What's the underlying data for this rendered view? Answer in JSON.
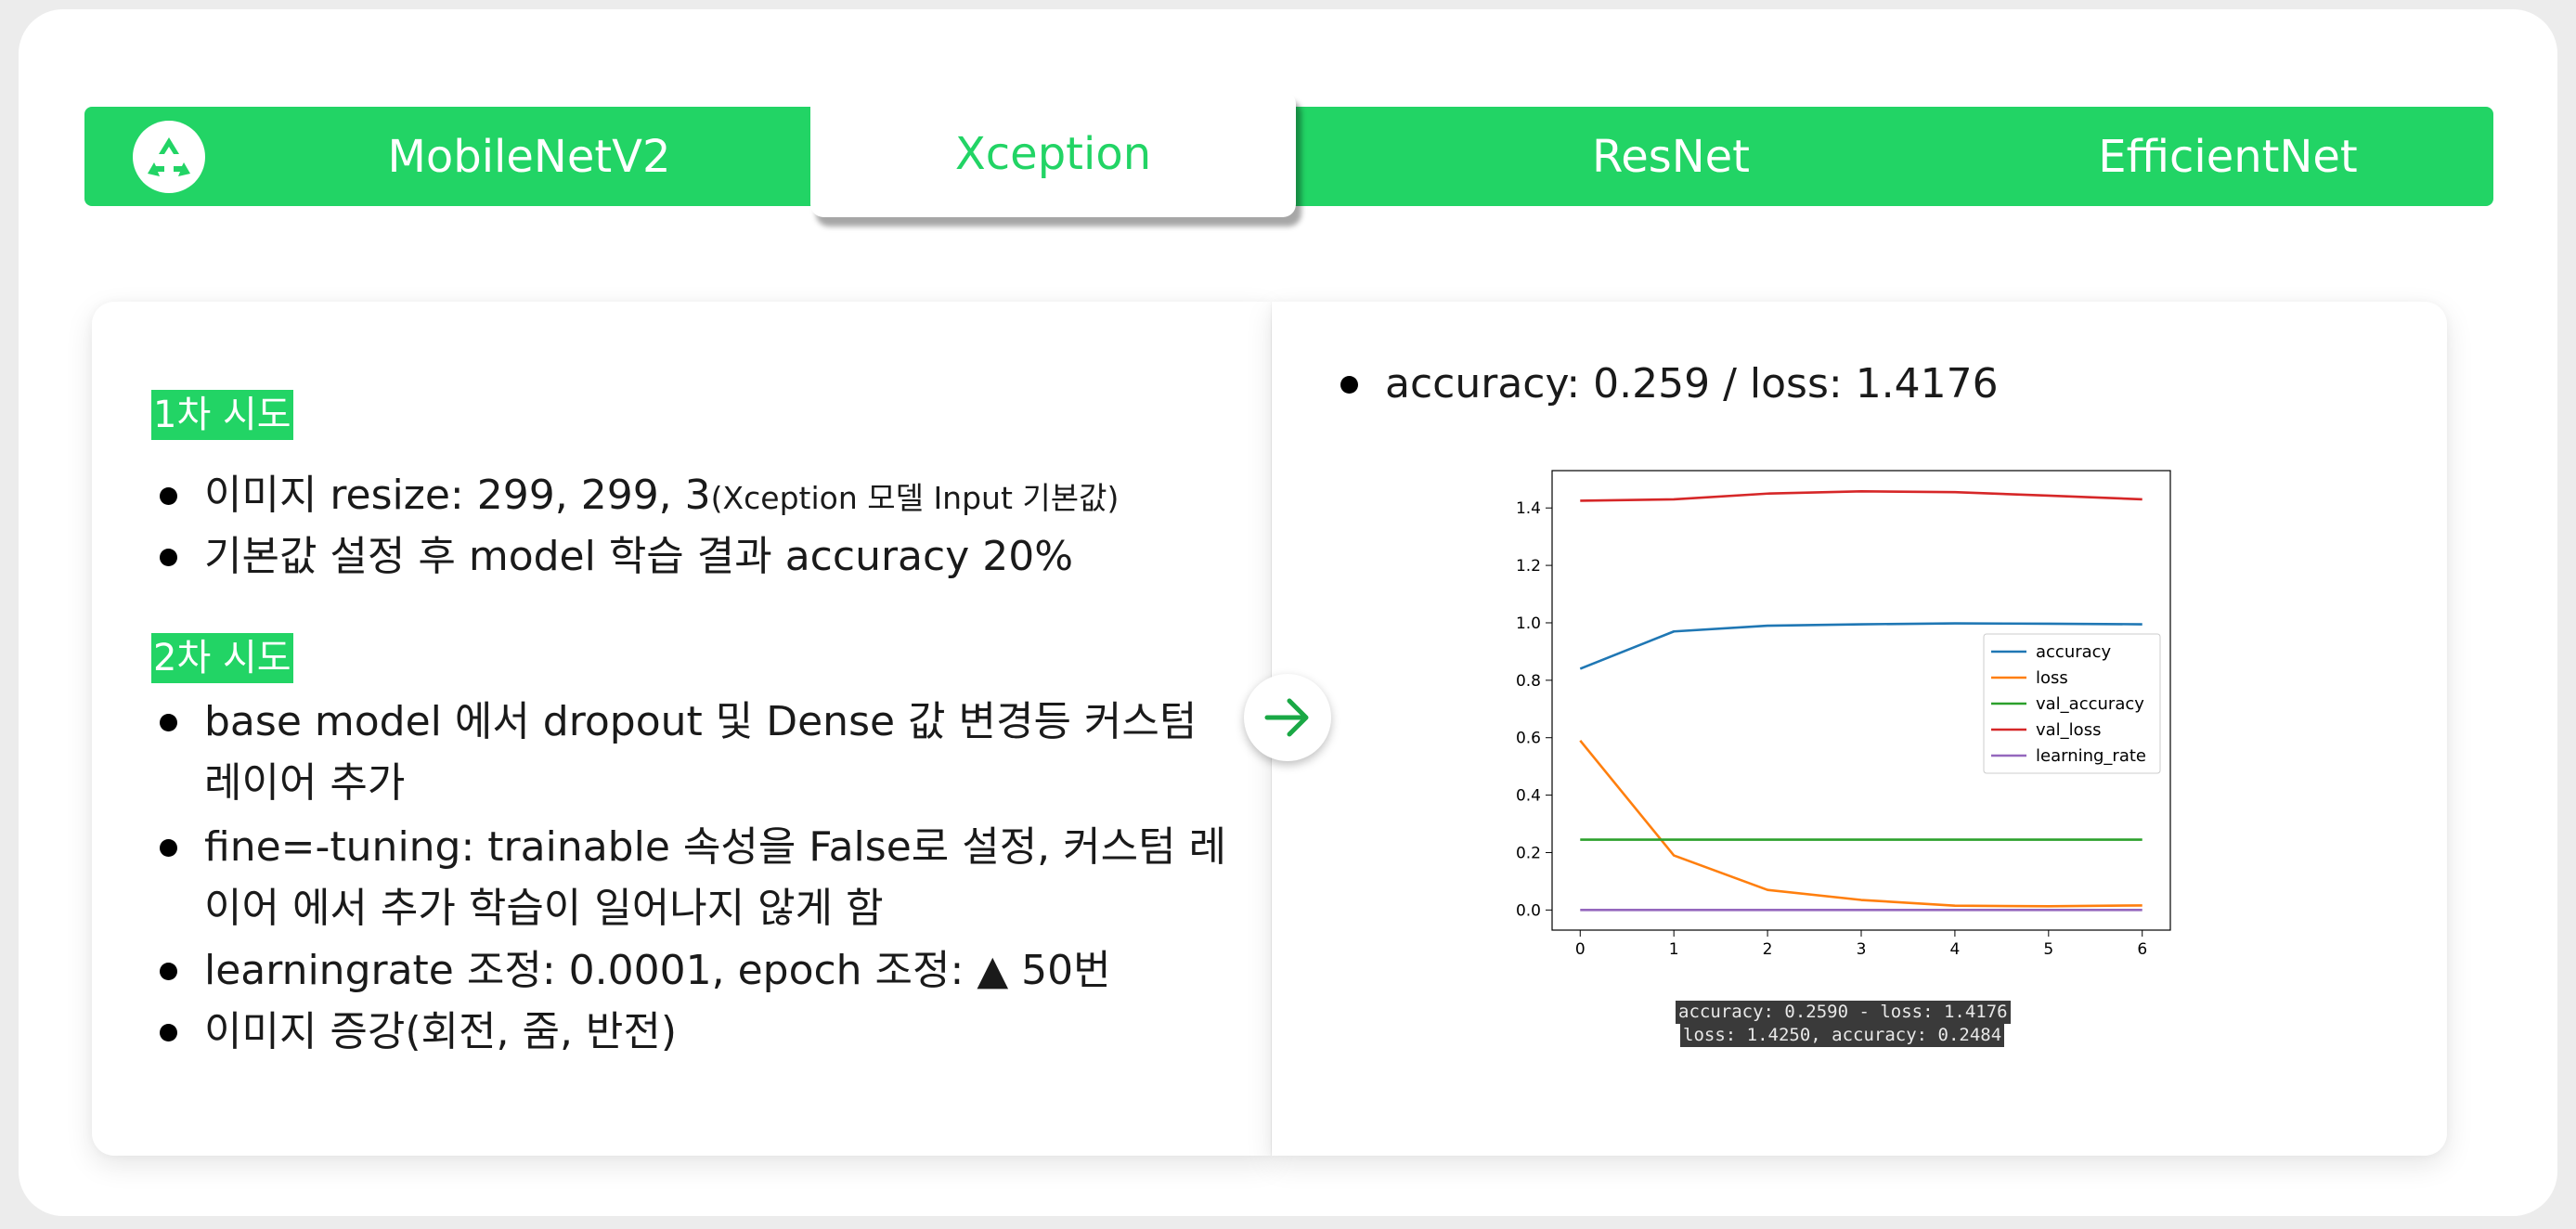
{
  "tabs": [
    {
      "label": "MobileNetV2",
      "active": false
    },
    {
      "label": "Xception",
      "active": true
    },
    {
      "label": "ResNet",
      "active": false
    },
    {
      "label": "EfficientNet",
      "active": false
    }
  ],
  "logo_icon": "recycle-icon",
  "arrow_icon": "arrow-right-icon",
  "colors": {
    "accent": "#22d465",
    "text": "#1a1a1a",
    "background": "#ececec"
  },
  "left": {
    "trial1": {
      "heading": "1차 시도",
      "bullets": [
        {
          "text": "이미지 resize: 299, 299, 3",
          "note": "(Xception 모델 Input 기본값)"
        },
        {
          "text": "기본값 설정 후 model 학습 결과 accuracy 20%"
        }
      ]
    },
    "trial2": {
      "heading": "2차 시도",
      "bullets": [
        {
          "lines": [
            "base model 에서 dropout 및 Dense 값 변경등 커스텀",
            "레이어 추가"
          ]
        },
        {
          "lines": [
            "fine=-tuning: trainable 속성을 False로 설정, 커스텀 레",
            "이어 에서 추가 학습이 일어나지 않게 함"
          ]
        },
        {
          "text": "learningrate 조정: 0.0001, epoch 조정: ▲ 50번"
        },
        {
          "text": "이미지 증강(회전, 줌, 반전)"
        }
      ]
    }
  },
  "right": {
    "summary": "accuracy: 0.259 / loss: 1.4176",
    "console_lines": [
      "accuracy: 0.2590 - loss: 1.4176",
      "loss: 1.4250, accuracy: 0.2484"
    ]
  },
  "chart_data": {
    "type": "line",
    "title": "",
    "xlabel": "",
    "ylabel": "",
    "x": [
      0,
      1,
      2,
      3,
      4,
      5,
      6
    ],
    "xticks": [
      "0",
      "1",
      "2",
      "3",
      "4",
      "5",
      "6"
    ],
    "yticks": [
      "0.0",
      "0.2",
      "0.4",
      "0.6",
      "0.8",
      "1.0",
      "1.2",
      "1.4"
    ],
    "xlim": [
      -0.3,
      6.3
    ],
    "ylim": [
      -0.07,
      1.53
    ],
    "grid": false,
    "legend_position": "center-right",
    "series": [
      {
        "name": "accuracy",
        "color": "#1f77b4",
        "values": [
          0.84,
          0.97,
          0.99,
          0.995,
          0.998,
          0.997,
          0.995
        ]
      },
      {
        "name": "loss",
        "color": "#ff7f0e",
        "values": [
          0.59,
          0.19,
          0.07,
          0.035,
          0.015,
          0.013,
          0.016
        ]
      },
      {
        "name": "val_accuracy",
        "color": "#2ca02c",
        "values": [
          0.245,
          0.245,
          0.245,
          0.245,
          0.245,
          0.245,
          0.245
        ]
      },
      {
        "name": "val_loss",
        "color": "#d62728",
        "values": [
          1.425,
          1.43,
          1.45,
          1.458,
          1.455,
          1.443,
          1.43
        ]
      },
      {
        "name": "learning_rate",
        "color": "#9467bd",
        "values": [
          0.0001,
          0.0001,
          0.0001,
          0.0001,
          0.0001,
          0.0001,
          0.0001
        ]
      }
    ]
  }
}
